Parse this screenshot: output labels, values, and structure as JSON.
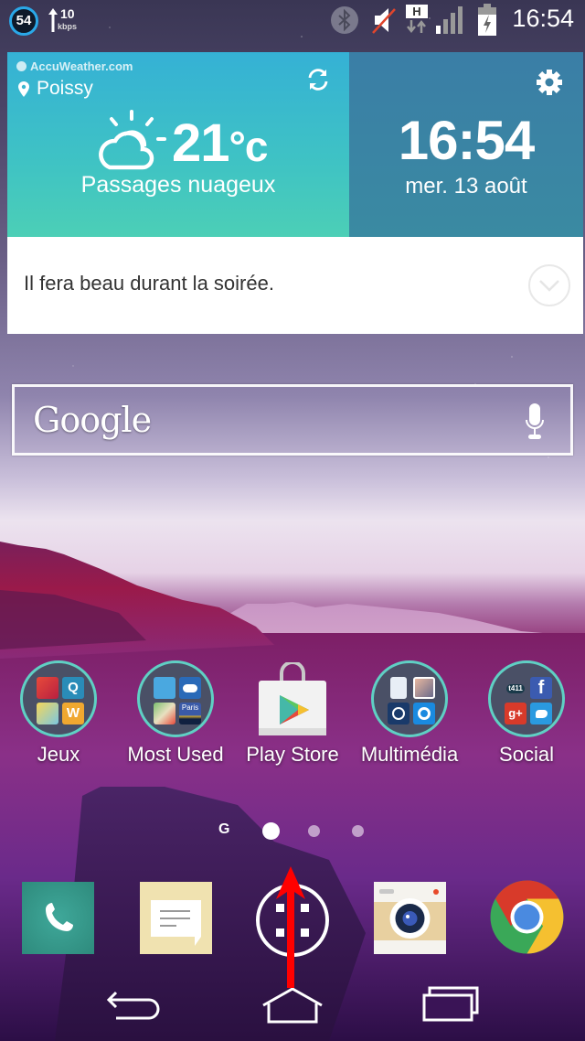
{
  "status_bar": {
    "badge_value": "54",
    "net_speed_value": "10",
    "net_speed_unit": "kbps",
    "icons": [
      "bluetooth-icon",
      "mute-icon",
      "h-network-data-icon",
      "signal-icon",
      "battery-charging-icon"
    ],
    "network_type": "H",
    "time": "16:54"
  },
  "weather_widget": {
    "provider": "AccuWeather.com",
    "location": "Poissy",
    "temperature": "21",
    "temperature_unit": "°c",
    "condition": "Passages nuageux",
    "condition_icon": "partly-cloudy-icon",
    "clock": "16:54",
    "date": "mer. 13 août",
    "forecast_text": "Il fera beau durant la soirée.",
    "colors": {
      "left_top": "#35b1d5",
      "left_bottom": "#4ccfb6",
      "right": "#3a84a4"
    }
  },
  "search_bar": {
    "logo_text": "Google",
    "mic_icon": "microphone-icon"
  },
  "apps": [
    {
      "label": "Jeux",
      "type": "folder",
      "mini_icons": [
        "Candy Crush",
        "Q",
        "Bubble game",
        "W"
      ]
    },
    {
      "label": "Most Used",
      "type": "folder",
      "mini_icons": [
        "ES File Explorer",
        "Weather",
        "Maps",
        "Paris"
      ]
    },
    {
      "label": "Play Store",
      "type": "app"
    },
    {
      "label": "Multimédia",
      "type": "folder",
      "mini_icons": [
        "File",
        "Gallery",
        "Napster",
        "Shazam"
      ]
    },
    {
      "label": "Social",
      "type": "folder",
      "mini_icons": [
        "t411",
        "f",
        "g+",
        "Twitter"
      ]
    }
  ],
  "folder_mini_text": {
    "q": "Q",
    "w": "W",
    "paris": "Paris",
    "facebook": "f",
    "gplus": "g+",
    "t411": "t411"
  },
  "page_indicator": {
    "g_label": "G",
    "pages": 3,
    "active_page": 1
  },
  "dock": [
    "Phone",
    "Messages",
    "Apps drawer",
    "Camera",
    "Chrome"
  ],
  "navigation": [
    "back",
    "home",
    "recent-apps"
  ],
  "annotation": {
    "type": "swipe-up-arrow",
    "color": "#ff0000"
  }
}
